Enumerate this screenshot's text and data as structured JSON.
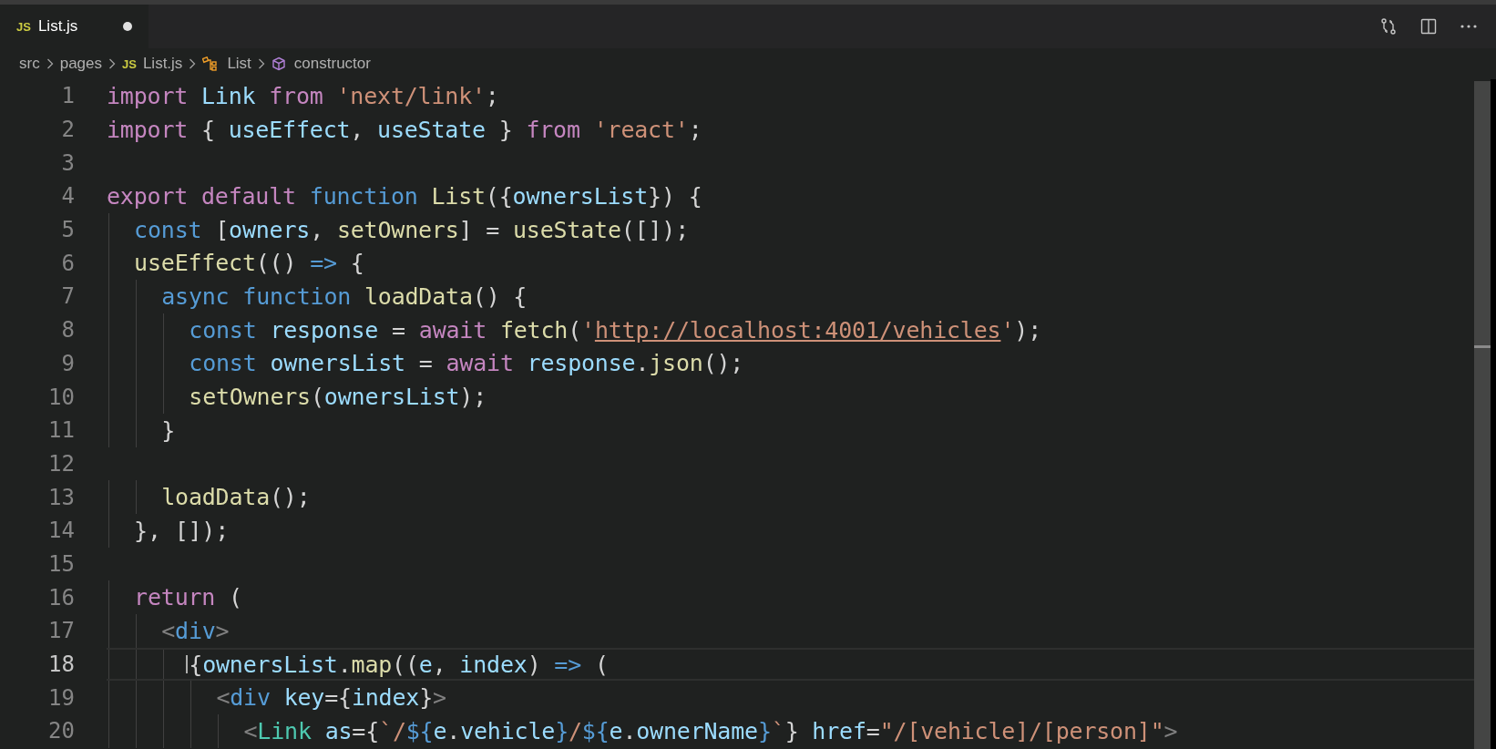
{
  "tab": {
    "badge": "JS",
    "label": "List.js",
    "selected": true,
    "modified": true
  },
  "breadcrumbs": [
    {
      "kind": "folder",
      "label": "src"
    },
    {
      "kind": "folder",
      "label": "pages"
    },
    {
      "kind": "file",
      "badge": "JS",
      "label": "List.js"
    },
    {
      "kind": "class",
      "label": "List"
    },
    {
      "kind": "method",
      "label": "constructor"
    }
  ],
  "lines": [
    {
      "no": "1",
      "current": false,
      "tokens": [
        {
          "text": "import",
          "kind": "kw"
        },
        {
          "text": " Link ",
          "kind": "var"
        },
        {
          "text": "from",
          "kind": "kw"
        },
        {
          "text": " 'next/link'",
          "kind": "str"
        },
        {
          "text": ";",
          "kind": "p"
        }
      ]
    },
    {
      "no": "2",
      "current": false,
      "tokens": [
        {
          "text": "import",
          "kind": "kw"
        },
        {
          "text": " { ",
          "kind": "p"
        },
        {
          "text": "useEffect",
          "kind": "var"
        },
        {
          "text": ", ",
          "kind": "p"
        },
        {
          "text": "useState",
          "kind": "var"
        },
        {
          "text": " } ",
          "kind": "p"
        },
        {
          "text": "from",
          "kind": "kw"
        },
        {
          "text": " 'react'",
          "kind": "str"
        },
        {
          "text": ";",
          "kind": "p"
        }
      ]
    },
    {
      "no": "3",
      "current": false
    },
    {
      "no": "4",
      "current": false,
      "tokens": [
        {
          "text": "export default ",
          "kind": "kw"
        },
        {
          "text": "function ",
          "kind": "st"
        },
        {
          "text": "List",
          "kind": "fn"
        },
        {
          "text": "({",
          "kind": "p"
        },
        {
          "text": "ownersList",
          "kind": "var"
        },
        {
          "text": "}) {",
          "kind": "p"
        }
      ]
    },
    {
      "no": "5",
      "current": false,
      "tokens": [
        {
          "text": "  const ",
          "kind": "st"
        },
        {
          "text": "[",
          "kind": "p"
        },
        {
          "text": "owners",
          "kind": "var"
        },
        {
          "text": ", ",
          "kind": "p"
        },
        {
          "text": "setOwners",
          "kind": "fn"
        },
        {
          "text": "] = ",
          "kind": "p"
        },
        {
          "text": "useState",
          "kind": "fn"
        },
        {
          "text": "([]);",
          "kind": "p"
        }
      ]
    },
    {
      "no": "6",
      "current": false,
      "tokens": [
        {
          "text": "  useEffect",
          "kind": "fn"
        },
        {
          "text": "(() ",
          "kind": "p"
        },
        {
          "text": "=>",
          "kind": "st"
        },
        {
          "text": " {",
          "kind": "p"
        }
      ]
    },
    {
      "no": "7",
      "current": false,
      "tokens": [
        {
          "text": "    async function ",
          "kind": "st"
        },
        {
          "text": "loadData",
          "kind": "fn"
        },
        {
          "text": "() {",
          "kind": "p"
        }
      ]
    },
    {
      "no": "8",
      "current": false,
      "tokens": [
        {
          "text": "      const ",
          "kind": "st"
        },
        {
          "text": "response",
          "kind": "var"
        },
        {
          "text": " = ",
          "kind": "p"
        },
        {
          "text": "await ",
          "kind": "kw"
        },
        {
          "text": "fetch",
          "kind": "fn"
        },
        {
          "text": "(",
          "kind": "p"
        },
        {
          "text": "'",
          "kind": "str"
        },
        {
          "text": "http://localhost:4001/vehicles",
          "kind": "link"
        },
        {
          "text": "'",
          "kind": "str"
        },
        {
          "text": ");",
          "kind": "p"
        }
      ]
    },
    {
      "no": "9",
      "current": false,
      "tokens": [
        {
          "text": "      const ",
          "kind": "st"
        },
        {
          "text": "ownersList",
          "kind": "var"
        },
        {
          "text": " = ",
          "kind": "p"
        },
        {
          "text": "await ",
          "kind": "kw"
        },
        {
          "text": "response",
          "kind": "var"
        },
        {
          "text": ".",
          "kind": "p"
        },
        {
          "text": "json",
          "kind": "fn"
        },
        {
          "text": "();",
          "kind": "p"
        }
      ]
    },
    {
      "no": "10",
      "current": false,
      "tokens": [
        {
          "text": "      setOwners",
          "kind": "fn"
        },
        {
          "text": "(",
          "kind": "p"
        },
        {
          "text": "ownersList",
          "kind": "var"
        },
        {
          "text": ");",
          "kind": "p"
        }
      ]
    },
    {
      "no": "11",
      "current": false,
      "tokens": [
        {
          "text": "    }",
          "kind": "p"
        }
      ]
    },
    {
      "no": "12",
      "current": false
    },
    {
      "no": "13",
      "current": false,
      "tokens": [
        {
          "text": "    loadData",
          "kind": "fn"
        },
        {
          "text": "();",
          "kind": "p"
        }
      ]
    },
    {
      "no": "14",
      "current": false,
      "tokens": [
        {
          "text": "  }, []);",
          "kind": "p"
        }
      ]
    },
    {
      "no": "15",
      "current": false
    },
    {
      "no": "16",
      "current": false,
      "tokens": [
        {
          "text": "  return",
          "kind": "kw"
        },
        {
          "text": " (",
          "kind": "p"
        }
      ]
    },
    {
      "no": "17",
      "current": false,
      "tokens": [
        {
          "text": "    <",
          "kind": "br"
        },
        {
          "text": "div",
          "kind": "st"
        },
        {
          "text": ">",
          "kind": "br"
        }
      ]
    },
    {
      "no": "18",
      "current": true,
      "tokens": [
        {
          "text": "      {",
          "kind": "p"
        },
        {
          "text": "ownersList",
          "kind": "var"
        },
        {
          "text": ".",
          "kind": "p"
        },
        {
          "text": "map",
          "kind": "fn"
        },
        {
          "text": "((",
          "kind": "p"
        },
        {
          "text": "e",
          "kind": "var"
        },
        {
          "text": ", ",
          "kind": "p"
        },
        {
          "text": "index",
          "kind": "var"
        },
        {
          "text": ") ",
          "kind": "p"
        },
        {
          "text": "=>",
          "kind": "st"
        },
        {
          "text": " (",
          "kind": "p"
        }
      ]
    },
    {
      "no": "19",
      "current": false,
      "tokens": [
        {
          "text": "        <",
          "kind": "br"
        },
        {
          "text": "div ",
          "kind": "st"
        },
        {
          "text": "key",
          "kind": "var"
        },
        {
          "text": "={",
          "kind": "p"
        },
        {
          "text": "index",
          "kind": "var"
        },
        {
          "text": "}",
          "kind": "p"
        },
        {
          "text": ">",
          "kind": "br"
        }
      ]
    },
    {
      "no": "20",
      "current": false,
      "tokens": [
        {
          "text": "          <",
          "kind": "br"
        },
        {
          "text": "Link ",
          "kind": "cls"
        },
        {
          "text": "as",
          "kind": "var"
        },
        {
          "text": "={",
          "kind": "p"
        },
        {
          "text": "`/",
          "kind": "str"
        },
        {
          "text": "${",
          "kind": "st"
        },
        {
          "text": "e",
          "kind": "var"
        },
        {
          "text": ".",
          "kind": "p"
        },
        {
          "text": "vehicle",
          "kind": "var"
        },
        {
          "text": "}",
          "kind": "st"
        },
        {
          "text": "/",
          "kind": "str"
        },
        {
          "text": "${",
          "kind": "st"
        },
        {
          "text": "e",
          "kind": "var"
        },
        {
          "text": ".",
          "kind": "p"
        },
        {
          "text": "ownerName",
          "kind": "var"
        },
        {
          "text": "}",
          "kind": "st"
        },
        {
          "text": "`",
          "kind": "str"
        },
        {
          "text": "} ",
          "kind": "p"
        },
        {
          "text": "href",
          "kind": "var"
        },
        {
          "text": "=",
          "kind": "p"
        },
        {
          "text": "\"/[vehicle]/[person]\"",
          "kind": "str"
        },
        {
          "text": ">",
          "kind": "br"
        }
      ]
    }
  ]
}
